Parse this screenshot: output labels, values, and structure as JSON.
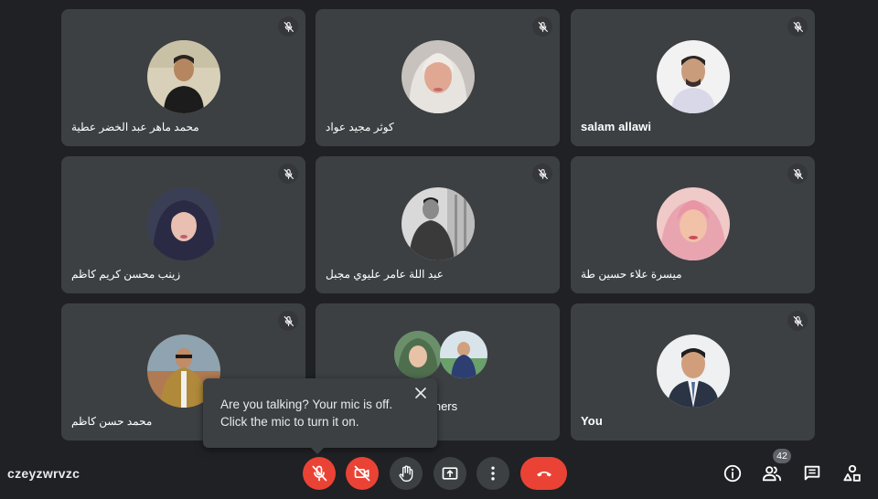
{
  "participants": [
    {
      "name": "محمد ماهر عبد الخضر عطية"
    },
    {
      "name": "كوثر مجيد عواد"
    },
    {
      "name": "salam allawi"
    },
    {
      "name": "زينب محسن كريم كاظم"
    },
    {
      "name": "عبد اللة عامر عليوي مجبل"
    },
    {
      "name": "ميسرة علاء حسين طة"
    },
    {
      "name": "محمد حسن كاظم"
    },
    {
      "name": "You"
    }
  ],
  "others_tile": {
    "label": "others"
  },
  "tooltip": {
    "line1": "Are you talking? Your mic is off.",
    "line2": "Click the mic to turn it on."
  },
  "meeting_code": "czeyzwrvzc",
  "people_count": "42",
  "colors": {
    "background": "#202124",
    "tile": "#3c4043",
    "danger": "#ea4335",
    "text": "#ffffff"
  },
  "icons": {
    "tile_status": "mic-off-icon",
    "controls": [
      "mic-off-icon",
      "camera-off-icon",
      "raise-hand-icon",
      "present-screen-icon",
      "more-options-icon",
      "end-call-icon"
    ],
    "side": [
      "info-icon",
      "people-icon",
      "chat-icon",
      "activities-icon"
    ]
  }
}
